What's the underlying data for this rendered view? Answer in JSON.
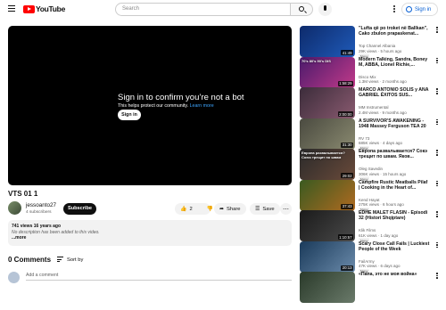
{
  "header": {
    "logo_text": "YouTube",
    "search_placeholder": "Search",
    "signin_label": "Sign in"
  },
  "player": {
    "title": "Sign in to confirm you’re not a bot",
    "subtitle_prefix": "This helps protect our community.",
    "learn_more": "Learn more",
    "signin_button": "Sign in"
  },
  "video": {
    "title": "VTS 01 1",
    "channel": "jessoanto27",
    "subscribers": "4 subscribers",
    "subscribe_label": "Subscribe",
    "likes": "2",
    "share_label": "Share",
    "save_label": "Save"
  },
  "description": {
    "stats": "741 views  16 years ago",
    "text": "No description has been added to this video.",
    "more": "...more"
  },
  "comments": {
    "count_label": "0 Comments",
    "sort_label": "Sort by",
    "add_placeholder": "Add a comment"
  },
  "sidebar": {
    "items": [
      {
        "title": "\"Lufta që po troket në Ballkan\", Cako zbulon prapaskenat...",
        "channel": "Top Channel Albania",
        "meta": "29K views · 5 hours ago",
        "badge": "New",
        "duration": "41:49",
        "thumb_colors": [
          "#0d2a6b",
          "#1f5ab8"
        ]
      },
      {
        "title": "Modern Talking, Sandra, Boney M, ABBA, Lionel Richie,...",
        "channel": "Disco Mix",
        "meta": "1.3M views · 2 months ago",
        "badge": "",
        "duration": "1:58:29",
        "thumb_colors": [
          "#4a1a6b",
          "#c23a8a"
        ],
        "thumb_text": "70's 80's 90's DIS"
      },
      {
        "title": "MARCO ANTONIO SOLÍS y ANA GABRIEL ÉXITOS SUS...",
        "channel": "MM Instrumental",
        "meta": "2.4M views · 9 months ago",
        "badge": "",
        "duration": "2:00:00",
        "thumb_colors": [
          "#3b2c3a",
          "#8a5a70"
        ]
      },
      {
        "title": "A SURVIVOR'S AWAKENING - 1948 Massey Ferguson TEA 20",
        "channel": "RV 73",
        "meta": "685K views · 4 days ago",
        "badge": "New",
        "duration": "31:30",
        "thumb_colors": [
          "#4a4a40",
          "#8a8a70"
        ]
      },
      {
        "title": "Европа развалывается? Сокэ трещит по швам. Яков...",
        "channel": "Oleg Savedin",
        "meta": "306K views · 15 hours ago",
        "badge": "New",
        "duration": "29:02",
        "thumb_colors": [
          "#2a2a2a",
          "#6a4a3a"
        ],
        "thumb_text": "Европа развалывается? Союз трещит по швам"
      },
      {
        "title": "Campfire Rustic Meatballs Pilaf | Cooking in the Heart of...",
        "channel": "Kend Hayat",
        "meta": "275K views · 6 hours ago",
        "badge": "New",
        "duration": "37:43",
        "thumb_colors": [
          "#3a5a20",
          "#b06a20"
        ]
      },
      {
        "title": "EDHE MALET FLASIN - Episodi 32 (Histori Shqiptare)",
        "channel": "Klik Films",
        "meta": "61K views · 1 day ago",
        "badge": "New",
        "duration": "1:10:57",
        "thumb_colors": [
          "#1a1a1a",
          "#4a4a4a"
        ]
      },
      {
        "title": "Scary Close Call Fails | Luckiest People of the Week",
        "channel": "FailArmy",
        "meta": "47K views · 6 days ago",
        "badge": "New",
        "duration": "20:13",
        "thumb_colors": [
          "#1a3a5a",
          "#6a8aaa"
        ]
      },
      {
        "title": "«Папа, это не моя война»",
        "channel": "",
        "meta": "",
        "badge": "",
        "duration": "",
        "thumb_colors": [
          "#2a3a2a",
          "#6a7a6a"
        ]
      }
    ]
  }
}
